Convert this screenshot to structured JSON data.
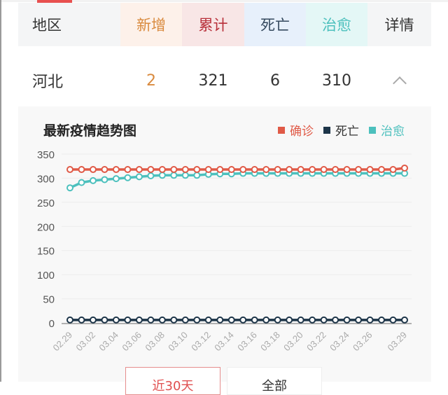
{
  "table": {
    "headers": {
      "region": "地区",
      "new": "新增",
      "total": "累计",
      "death": "死亡",
      "cured": "治愈",
      "detail": "详情"
    },
    "row": {
      "region": "河北",
      "new": "2",
      "total": "321",
      "death": "6",
      "cured": "310",
      "detail_icon": "chevron-up-icon"
    }
  },
  "chart_panel": {
    "title": "最新疫情趋势图",
    "buttons": {
      "last30": "近30天",
      "all": "全部"
    }
  },
  "chart_data": {
    "type": "line",
    "title": "最新疫情趋势图",
    "xlabel": "",
    "ylabel": "",
    "ylim": [
      0,
      350
    ],
    "yticks": [
      0,
      50,
      100,
      150,
      200,
      250,
      300,
      350
    ],
    "grid": true,
    "legend_position": "top-right",
    "x": [
      "02.29",
      "03.01",
      "03.02",
      "03.03",
      "03.04",
      "03.05",
      "03.06",
      "03.07",
      "03.08",
      "03.09",
      "03.10",
      "03.11",
      "03.12",
      "03.13",
      "03.14",
      "03.15",
      "03.16",
      "03.17",
      "03.18",
      "03.19",
      "03.20",
      "03.21",
      "03.22",
      "03.23",
      "03.24",
      "03.25",
      "03.26",
      "03.27",
      "03.28",
      "03.29"
    ],
    "xtick_labels": [
      "02.29",
      "03.02",
      "03.04",
      "03.06",
      "03.08",
      "03.10",
      "03.12",
      "03.14",
      "03.16",
      "03.18",
      "03.20",
      "03.22",
      "03.24",
      "03.26",
      "03.29"
    ],
    "xtick_indices": [
      0,
      2,
      4,
      6,
      8,
      10,
      12,
      14,
      16,
      18,
      20,
      22,
      24,
      26,
      29
    ],
    "series": [
      {
        "name": "确诊",
        "color": "#e05a47",
        "values": [
          318,
          318,
          318,
          318,
          318,
          318,
          318,
          318,
          318,
          318,
          318,
          318,
          318,
          318,
          318,
          318,
          318,
          318,
          318,
          318,
          318,
          318,
          318,
          318,
          318,
          318,
          318,
          318,
          318,
          321
        ]
      },
      {
        "name": "死亡",
        "color": "#1d3549",
        "values": [
          6,
          6,
          6,
          6,
          6,
          6,
          6,
          6,
          6,
          6,
          6,
          6,
          6,
          6,
          6,
          6,
          6,
          6,
          6,
          6,
          6,
          6,
          6,
          6,
          6,
          6,
          6,
          6,
          6,
          6
        ]
      },
      {
        "name": "治愈",
        "color": "#4cc0bd",
        "values": [
          280,
          291,
          295,
          297,
          299,
          301,
          303,
          305,
          306,
          306,
          306,
          306,
          308,
          309,
          309,
          310,
          310,
          310,
          310,
          310,
          310,
          310,
          310,
          310,
          310,
          310,
          310,
          310,
          310,
          310
        ]
      }
    ]
  }
}
